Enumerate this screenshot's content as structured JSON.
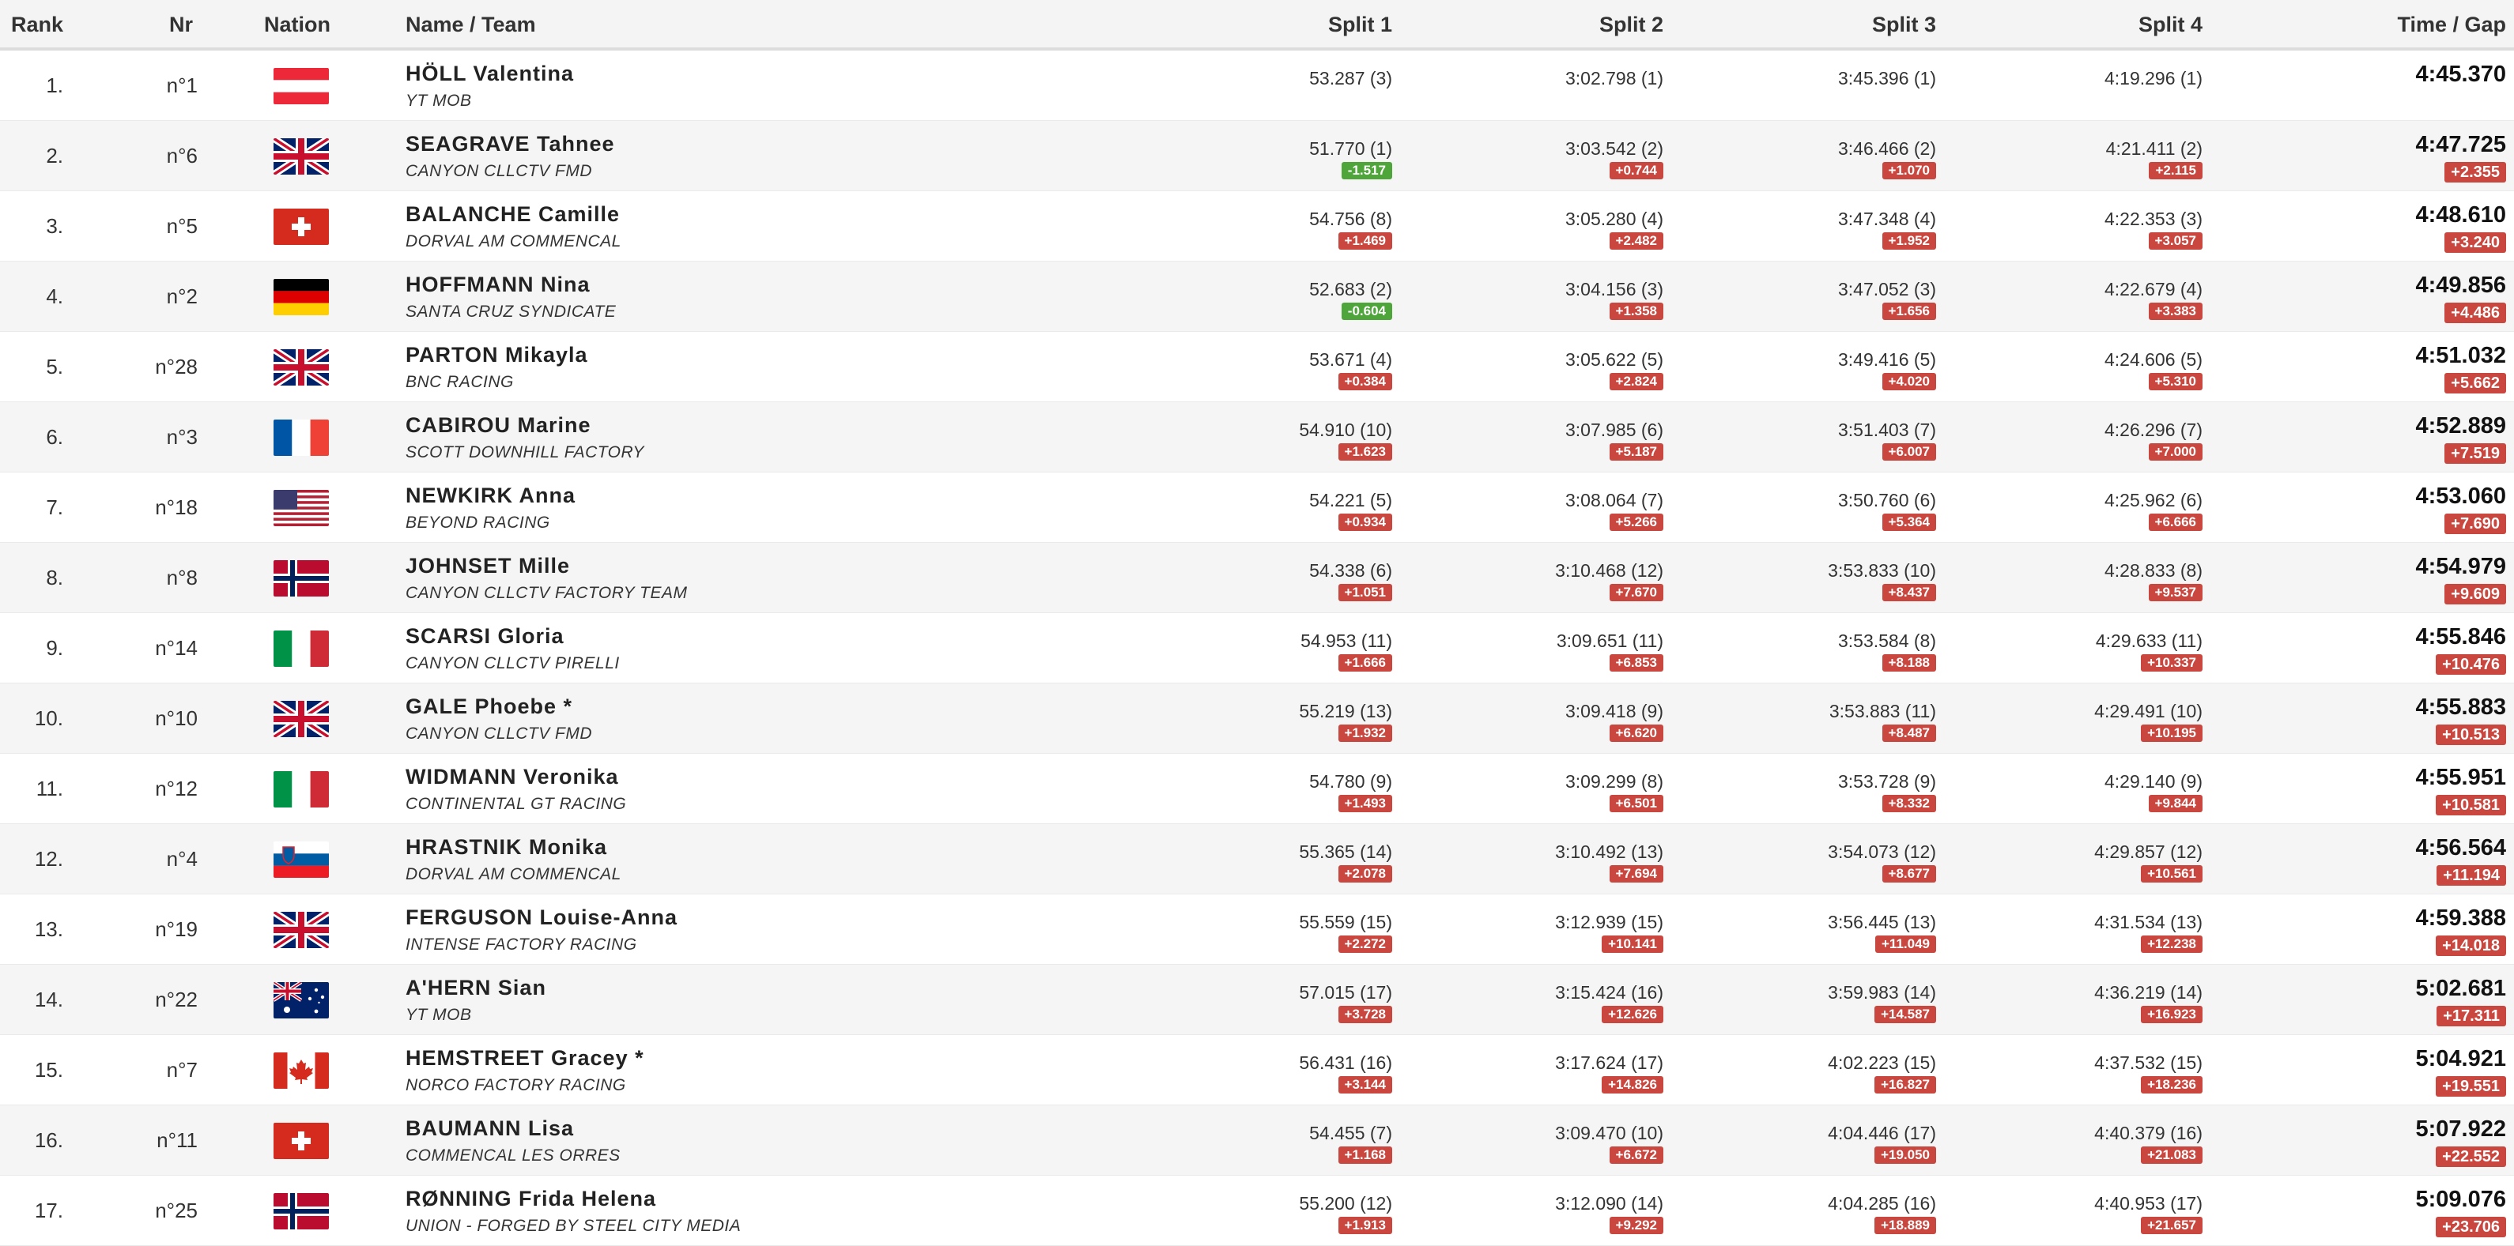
{
  "header": {
    "rank": "Rank",
    "nr": "Nr",
    "nation": "Nation",
    "name": "Name / Team",
    "split1": "Split 1",
    "split2": "Split 2",
    "split3": "Split 3",
    "split4": "Split 4",
    "time": "Time / Gap"
  },
  "rows": [
    {
      "rank": "1.",
      "nr": "n°1",
      "nation": "AUT",
      "name": "HÖLL Valentina",
      "team": "YT MOB",
      "s1": "53.287 (3)",
      "g1": "",
      "s2": "3:02.798 (1)",
      "g2": "",
      "s3": "3:45.396 (1)",
      "g3": "",
      "s4": "4:19.296 (1)",
      "g4": "",
      "time": "4:45.370",
      "gap": ""
    },
    {
      "rank": "2.",
      "nr": "n°6",
      "nation": "GBR",
      "name": "SEAGRAVE Tahnee",
      "team": "CANYON CLLCTV FMD",
      "s1": "51.770 (1)",
      "g1": "-1.517",
      "s2": "3:03.542 (2)",
      "g2": "+0.744",
      "s3": "3:46.466 (2)",
      "g3": "+1.070",
      "s4": "4:21.411 (2)",
      "g4": "+2.115",
      "time": "4:47.725",
      "gap": "+2.355"
    },
    {
      "rank": "3.",
      "nr": "n°5",
      "nation": "SUI",
      "name": "BALANCHE Camille",
      "team": "DORVAL AM COMMENCAL",
      "s1": "54.756 (8)",
      "g1": "+1.469",
      "s2": "3:05.280 (4)",
      "g2": "+2.482",
      "s3": "3:47.348 (4)",
      "g3": "+1.952",
      "s4": "4:22.353 (3)",
      "g4": "+3.057",
      "time": "4:48.610",
      "gap": "+3.240"
    },
    {
      "rank": "4.",
      "nr": "n°2",
      "nation": "GER",
      "name": "HOFFMANN Nina",
      "team": "SANTA CRUZ SYNDICATE",
      "s1": "52.683 (2)",
      "g1": "-0.604",
      "s2": "3:04.156 (3)",
      "g2": "+1.358",
      "s3": "3:47.052 (3)",
      "g3": "+1.656",
      "s4": "4:22.679 (4)",
      "g4": "+3.383",
      "time": "4:49.856",
      "gap": "+4.486"
    },
    {
      "rank": "5.",
      "nr": "n°28",
      "nation": "GBR",
      "name": "PARTON Mikayla",
      "team": "BNC RACING",
      "s1": "53.671 (4)",
      "g1": "+0.384",
      "s2": "3:05.622 (5)",
      "g2": "+2.824",
      "s3": "3:49.416 (5)",
      "g3": "+4.020",
      "s4": "4:24.606 (5)",
      "g4": "+5.310",
      "time": "4:51.032",
      "gap": "+5.662"
    },
    {
      "rank": "6.",
      "nr": "n°3",
      "nation": "FRA",
      "name": "CABIROU Marine",
      "team": "SCOTT DOWNHILL FACTORY",
      "s1": "54.910 (10)",
      "g1": "+1.623",
      "s2": "3:07.985 (6)",
      "g2": "+5.187",
      "s3": "3:51.403 (7)",
      "g3": "+6.007",
      "s4": "4:26.296 (7)",
      "g4": "+7.000",
      "time": "4:52.889",
      "gap": "+7.519"
    },
    {
      "rank": "7.",
      "nr": "n°18",
      "nation": "USA",
      "name": "NEWKIRK Anna",
      "team": "BEYOND RACING",
      "s1": "54.221 (5)",
      "g1": "+0.934",
      "s2": "3:08.064 (7)",
      "g2": "+5.266",
      "s3": "3:50.760 (6)",
      "g3": "+5.364",
      "s4": "4:25.962 (6)",
      "g4": "+6.666",
      "time": "4:53.060",
      "gap": "+7.690"
    },
    {
      "rank": "8.",
      "nr": "n°8",
      "nation": "NOR",
      "name": "JOHNSET Mille",
      "team": "CANYON CLLCTV FACTORY TEAM",
      "s1": "54.338 (6)",
      "g1": "+1.051",
      "s2": "3:10.468 (12)",
      "g2": "+7.670",
      "s3": "3:53.833 (10)",
      "g3": "+8.437",
      "s4": "4:28.833 (8)",
      "g4": "+9.537",
      "time": "4:54.979",
      "gap": "+9.609"
    },
    {
      "rank": "9.",
      "nr": "n°14",
      "nation": "ITA",
      "name": "SCARSI Gloria",
      "team": "CANYON CLLCTV PIRELLI",
      "s1": "54.953 (11)",
      "g1": "+1.666",
      "s2": "3:09.651 (11)",
      "g2": "+6.853",
      "s3": "3:53.584 (8)",
      "g3": "+8.188",
      "s4": "4:29.633 (11)",
      "g4": "+10.337",
      "time": "4:55.846",
      "gap": "+10.476"
    },
    {
      "rank": "10.",
      "nr": "n°10",
      "nation": "GBR",
      "name": "GALE Phoebe *",
      "team": "CANYON CLLCTV FMD",
      "s1": "55.219 (13)",
      "g1": "+1.932",
      "s2": "3:09.418 (9)",
      "g2": "+6.620",
      "s3": "3:53.883 (11)",
      "g3": "+8.487",
      "s4": "4:29.491 (10)",
      "g4": "+10.195",
      "time": "4:55.883",
      "gap": "+10.513"
    },
    {
      "rank": "11.",
      "nr": "n°12",
      "nation": "ITA",
      "name": "WIDMANN Veronika",
      "team": "CONTINENTAL GT RACING",
      "s1": "54.780 (9)",
      "g1": "+1.493",
      "s2": "3:09.299 (8)",
      "g2": "+6.501",
      "s3": "3:53.728 (9)",
      "g3": "+8.332",
      "s4": "4:29.140 (9)",
      "g4": "+9.844",
      "time": "4:55.951",
      "gap": "+10.581"
    },
    {
      "rank": "12.",
      "nr": "n°4",
      "nation": "SLO",
      "name": "HRASTNIK Monika",
      "team": "DORVAL AM COMMENCAL",
      "s1": "55.365 (14)",
      "g1": "+2.078",
      "s2": "3:10.492 (13)",
      "g2": "+7.694",
      "s3": "3:54.073 (12)",
      "g3": "+8.677",
      "s4": "4:29.857 (12)",
      "g4": "+10.561",
      "time": "4:56.564",
      "gap": "+11.194"
    },
    {
      "rank": "13.",
      "nr": "n°19",
      "nation": "GBR",
      "name": "FERGUSON Louise-Anna",
      "team": "INTENSE FACTORY RACING",
      "s1": "55.559 (15)",
      "g1": "+2.272",
      "s2": "3:12.939 (15)",
      "g2": "+10.141",
      "s3": "3:56.445 (13)",
      "g3": "+11.049",
      "s4": "4:31.534 (13)",
      "g4": "+12.238",
      "time": "4:59.388",
      "gap": "+14.018"
    },
    {
      "rank": "14.",
      "nr": "n°22",
      "nation": "AUS",
      "name": "A'HERN Sian",
      "team": "YT MOB",
      "s1": "57.015 (17)",
      "g1": "+3.728",
      "s2": "3:15.424 (16)",
      "g2": "+12.626",
      "s3": "3:59.983 (14)",
      "g3": "+14.587",
      "s4": "4:36.219 (14)",
      "g4": "+16.923",
      "time": "5:02.681",
      "gap": "+17.311"
    },
    {
      "rank": "15.",
      "nr": "n°7",
      "nation": "CAN",
      "name": "HEMSTREET Gracey *",
      "team": "NORCO FACTORY RACING",
      "s1": "56.431 (16)",
      "g1": "+3.144",
      "s2": "3:17.624 (17)",
      "g2": "+14.826",
      "s3": "4:02.223 (15)",
      "g3": "+16.827",
      "s4": "4:37.532 (15)",
      "g4": "+18.236",
      "time": "5:04.921",
      "gap": "+19.551"
    },
    {
      "rank": "16.",
      "nr": "n°11",
      "nation": "SUI",
      "name": "BAUMANN Lisa",
      "team": "COMMENCAL LES ORRES",
      "s1": "54.455 (7)",
      "g1": "+1.168",
      "s2": "3:09.470 (10)",
      "g2": "+6.672",
      "s3": "4:04.446 (17)",
      "g3": "+19.050",
      "s4": "4:40.379 (16)",
      "g4": "+21.083",
      "time": "5:07.922",
      "gap": "+22.552"
    },
    {
      "rank": "17.",
      "nr": "n°25",
      "nation": "NOR",
      "name": "RØNNING Frida Helena",
      "team": "UNION - FORGED BY STEEL CITY MEDIA",
      "s1": "55.200 (12)",
      "g1": "+1.913",
      "s2": "3:12.090 (14)",
      "g2": "+9.292",
      "s3": "4:04.285 (16)",
      "g3": "+18.889",
      "s4": "4:40.953 (17)",
      "g4": "+21.657",
      "time": "5:09.076",
      "gap": "+23.706"
    }
  ]
}
